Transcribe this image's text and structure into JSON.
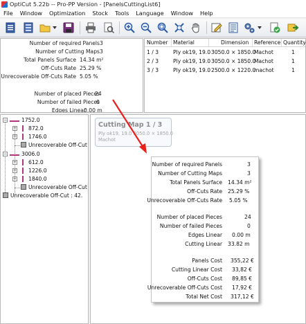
{
  "window": {
    "title": "OptiCut 5.22b -- Pro-PP Version - [PanelsCuttingList6]"
  },
  "menu": [
    "File",
    "Window",
    "Optimization",
    "Stock",
    "Tools",
    "Language",
    "Window",
    "Help"
  ],
  "toolbar": {
    "buttons": [
      "new-document-icon",
      "open-icon",
      "folder-icon",
      "save-icon",
      "print-icon",
      "print-preview-icon",
      "zoom-in-icon",
      "zoom-out-icon",
      "zoom-fit-icon",
      "zoom-all-icon",
      "pan-hand-icon",
      "edit-icon",
      "list-icon",
      "settings-icon",
      "validate-icon",
      "export-icon"
    ]
  },
  "stats": [
    {
      "label": "Number of required Panels",
      "value": "3"
    },
    {
      "label": "Number of Cutting Maps",
      "value": "3"
    },
    {
      "label": "Total Panels Surface",
      "value": "14.34 m²"
    },
    {
      "label": "Off-Cuts Rate",
      "value": "25.29 %"
    },
    {
      "label": "Unrecoverable Off-Cuts Rate",
      "value": "5.05 %"
    },
    {
      "label": "Number of placed Pieces",
      "value": "24"
    },
    {
      "label": "Number of failed Pieces",
      "value": "0"
    },
    {
      "label": "Edges Linear",
      "value": "0.00 m"
    }
  ],
  "table": {
    "headers": [
      "Number",
      "Material",
      "Dimension",
      "Reference",
      "Quantity"
    ],
    "rows": [
      [
        "1 / 3",
        "Ply ok19, 19.0",
        "3050.0 × 1850.0",
        "Machot",
        "1"
      ],
      [
        "2 / 3",
        "Ply ok19, 19.0",
        "3050.0 × 1850.0",
        "Machot",
        "1"
      ],
      [
        "3 / 3",
        "Ply ok19, 19.0",
        "2500.0 × 1220.0",
        "machot",
        "1"
      ]
    ]
  },
  "tree": {
    "group1": {
      "label": "1752.0",
      "children": [
        "872.0",
        "1746.0"
      ],
      "offcut": "Unrecoverable Off-Cut :"
    },
    "group2": {
      "label": "3006.0",
      "children": [
        "612.0",
        "1226.0",
        "1840.0"
      ],
      "offcut": "Unrecoverable Off-Cut :"
    },
    "root_offcut": "Unrecoverable Off-Cut : 42."
  },
  "map_card": {
    "title": "Cutting Map 1 / 3",
    "line1": "Ply ok19, 19.0 3050.0 × 1850.0",
    "line2": "Machot"
  },
  "popup": [
    {
      "label": "Number of required Panels",
      "value": "3"
    },
    {
      "label": "Number of Cutting Maps",
      "value": "3"
    },
    {
      "label": "Total Panels Surface",
      "value": "14.34 m²"
    },
    {
      "label": "Off-Cuts Rate",
      "value": "25.29 %"
    },
    {
      "label": "Unrecoverable Off-Cuts Rate",
      "value": "5.05 %"
    },
    {
      "label": "Number of placed Pieces",
      "value": "24"
    },
    {
      "label": "Number of failed Pieces",
      "value": "0"
    },
    {
      "label": "Edges Linear",
      "value": "0.00 m"
    },
    {
      "label": "Cutting Linear",
      "value": "33.82 m"
    },
    {
      "label": "Panels Cost",
      "value": "355,22 €"
    },
    {
      "label": "Cutting Linear Cost",
      "value": "33,82 €"
    },
    {
      "label": "Off-Cuts Cost",
      "value": "89,85 €"
    },
    {
      "label": "Unrecoverable Off-Cuts Cost",
      "value": "17,92 €"
    },
    {
      "label": "Total Net Cost",
      "value": "317,12 €"
    }
  ],
  "colors": {
    "accent_arrow": "#e8211c",
    "tree_bar": "#b3367d",
    "offcut": "#a9a9a9"
  }
}
